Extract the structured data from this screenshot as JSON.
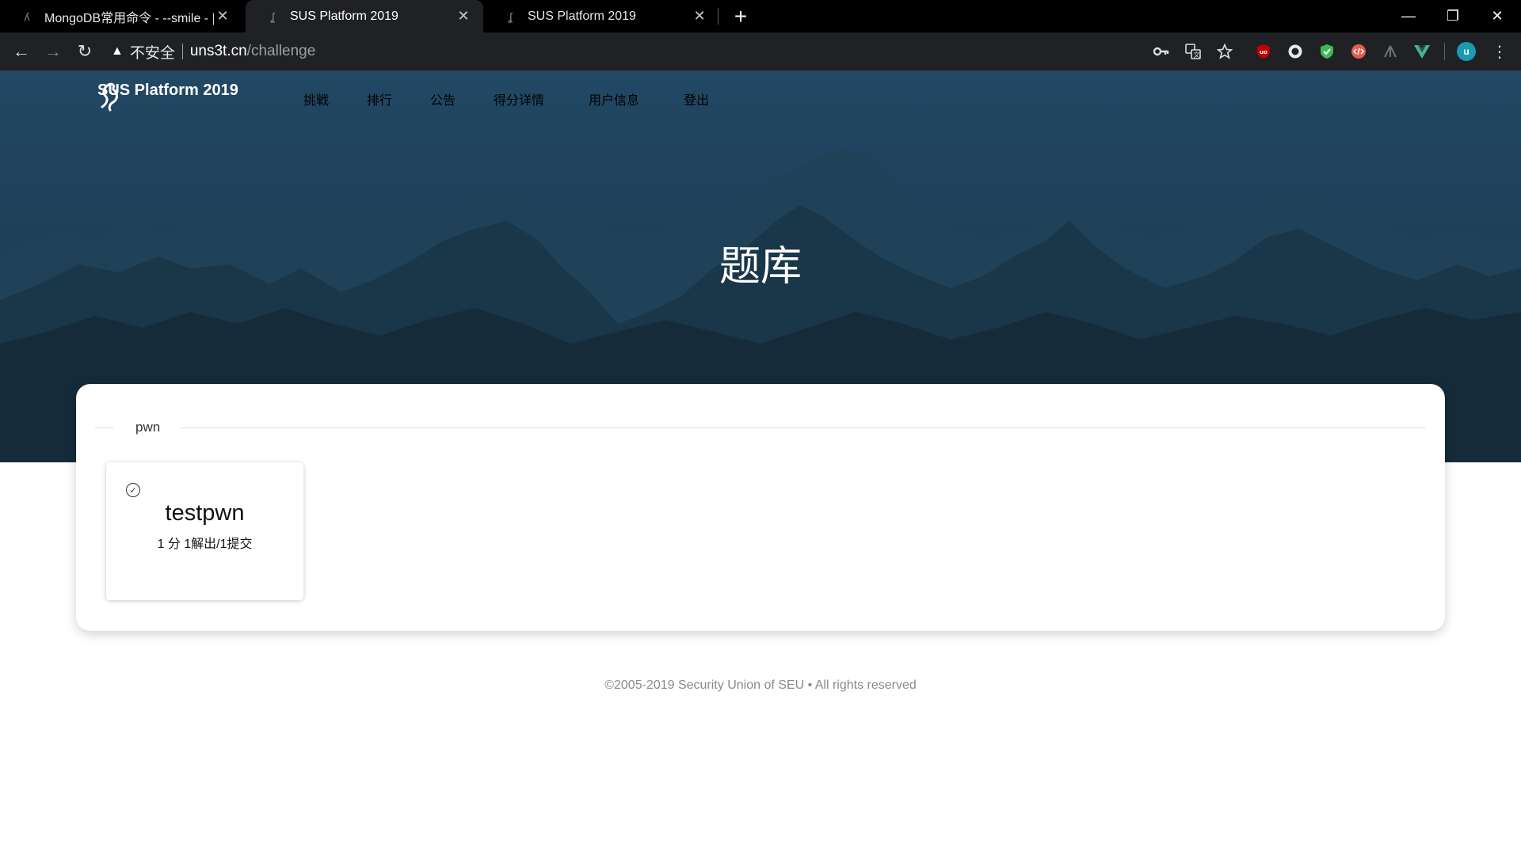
{
  "browser": {
    "tabs": [
      {
        "title": "MongoDB常用命令 - --smile - |",
        "active": false
      },
      {
        "title": "SUS Platform 2019",
        "active": true
      },
      {
        "title": "SUS Platform 2019",
        "active": false
      }
    ],
    "new_tab_label": "+",
    "window_controls": {
      "minimize": "—",
      "restore": "❐",
      "close": "✕"
    },
    "toolbar": {
      "back": "←",
      "forward": "→",
      "reload": "↻",
      "security_label": "不安全",
      "url_host": "uns3t.cn",
      "url_path": "/challenge",
      "profile_initial": "u",
      "menu": "⋮"
    },
    "extensions": [
      "key-icon",
      "translate-icon",
      "bookmark-star-icon",
      "ublock-icon",
      "circle-extension-icon",
      "shield-extension-icon",
      "code-extension-icon",
      "tree-extension-icon",
      "vue-devtools-icon"
    ]
  },
  "site": {
    "brand": "SUS Platform 2019",
    "nav": [
      "挑戦",
      "排行",
      "公告",
      "得分详情",
      "用户信息",
      "登出"
    ],
    "hero_title": "题库"
  },
  "categories": [
    {
      "name": "pwn",
      "challenges": [
        {
          "name": "testpwn",
          "meta": "1 分 1解出/1提交",
          "solved": true
        }
      ]
    }
  ],
  "footer": "©2005-2019 Security Union of SEU • All rights reserved",
  "colors": {
    "hero": "#224865",
    "browser_frame": "#000000",
    "toolbar": "#202124"
  }
}
